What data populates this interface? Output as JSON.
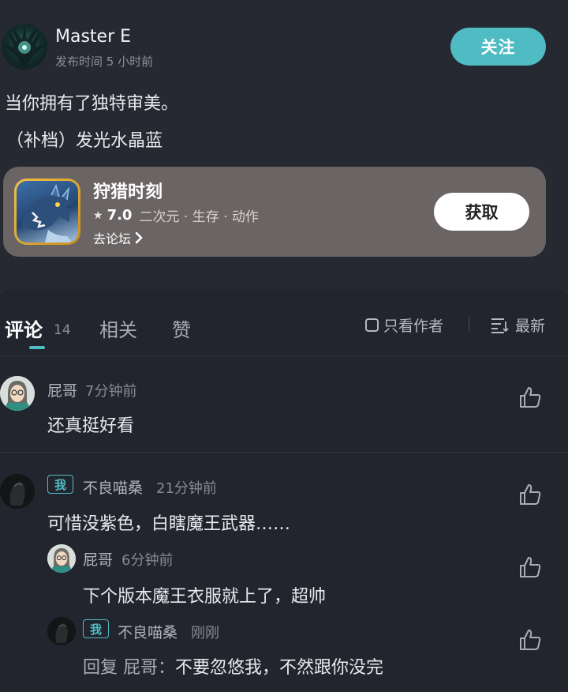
{
  "post": {
    "author_name": "Master E",
    "publish_time": "发布时间 5 小时前",
    "follow_label": "关注",
    "content_line1": "当你拥有了独特审美。",
    "content_line2": "（补档）发光水晶蓝"
  },
  "game_card": {
    "title": "狩猎时刻",
    "rating": "7.0",
    "tags": "二次元 · 生存 · 动作",
    "forum_link": "去论坛",
    "get_label": "获取",
    "star_icon": "star-icon",
    "chevron_icon": "chevron-right-icon"
  },
  "tabs": {
    "comments_label": "评论",
    "comments_count": "14",
    "related_label": "相关",
    "likes_label": "赞",
    "author_only_label": "只看作者",
    "sort_label": "最新"
  },
  "comments": [
    {
      "name": "屁哥",
      "time": "7分钟前",
      "text": "还真挺好看"
    },
    {
      "badge": "我",
      "name": "不良喵桑",
      "time": "21分钟前",
      "text": "可惜没紫色，白瞎魔王武器……",
      "replies": [
        {
          "name": "屁哥",
          "time": "6分钟前",
          "text": "下个版本魔王衣服就上了，超帅"
        },
        {
          "badge": "我",
          "name": "不良喵桑",
          "time": "刚刚",
          "reply_prefix": "回复 屁哥：",
          "text": "不要忽悠我，不然跟你没完"
        }
      ]
    }
  ],
  "colors": {
    "accent": "#4fbcc4",
    "background": "#22252e",
    "card": "#6b6464"
  }
}
